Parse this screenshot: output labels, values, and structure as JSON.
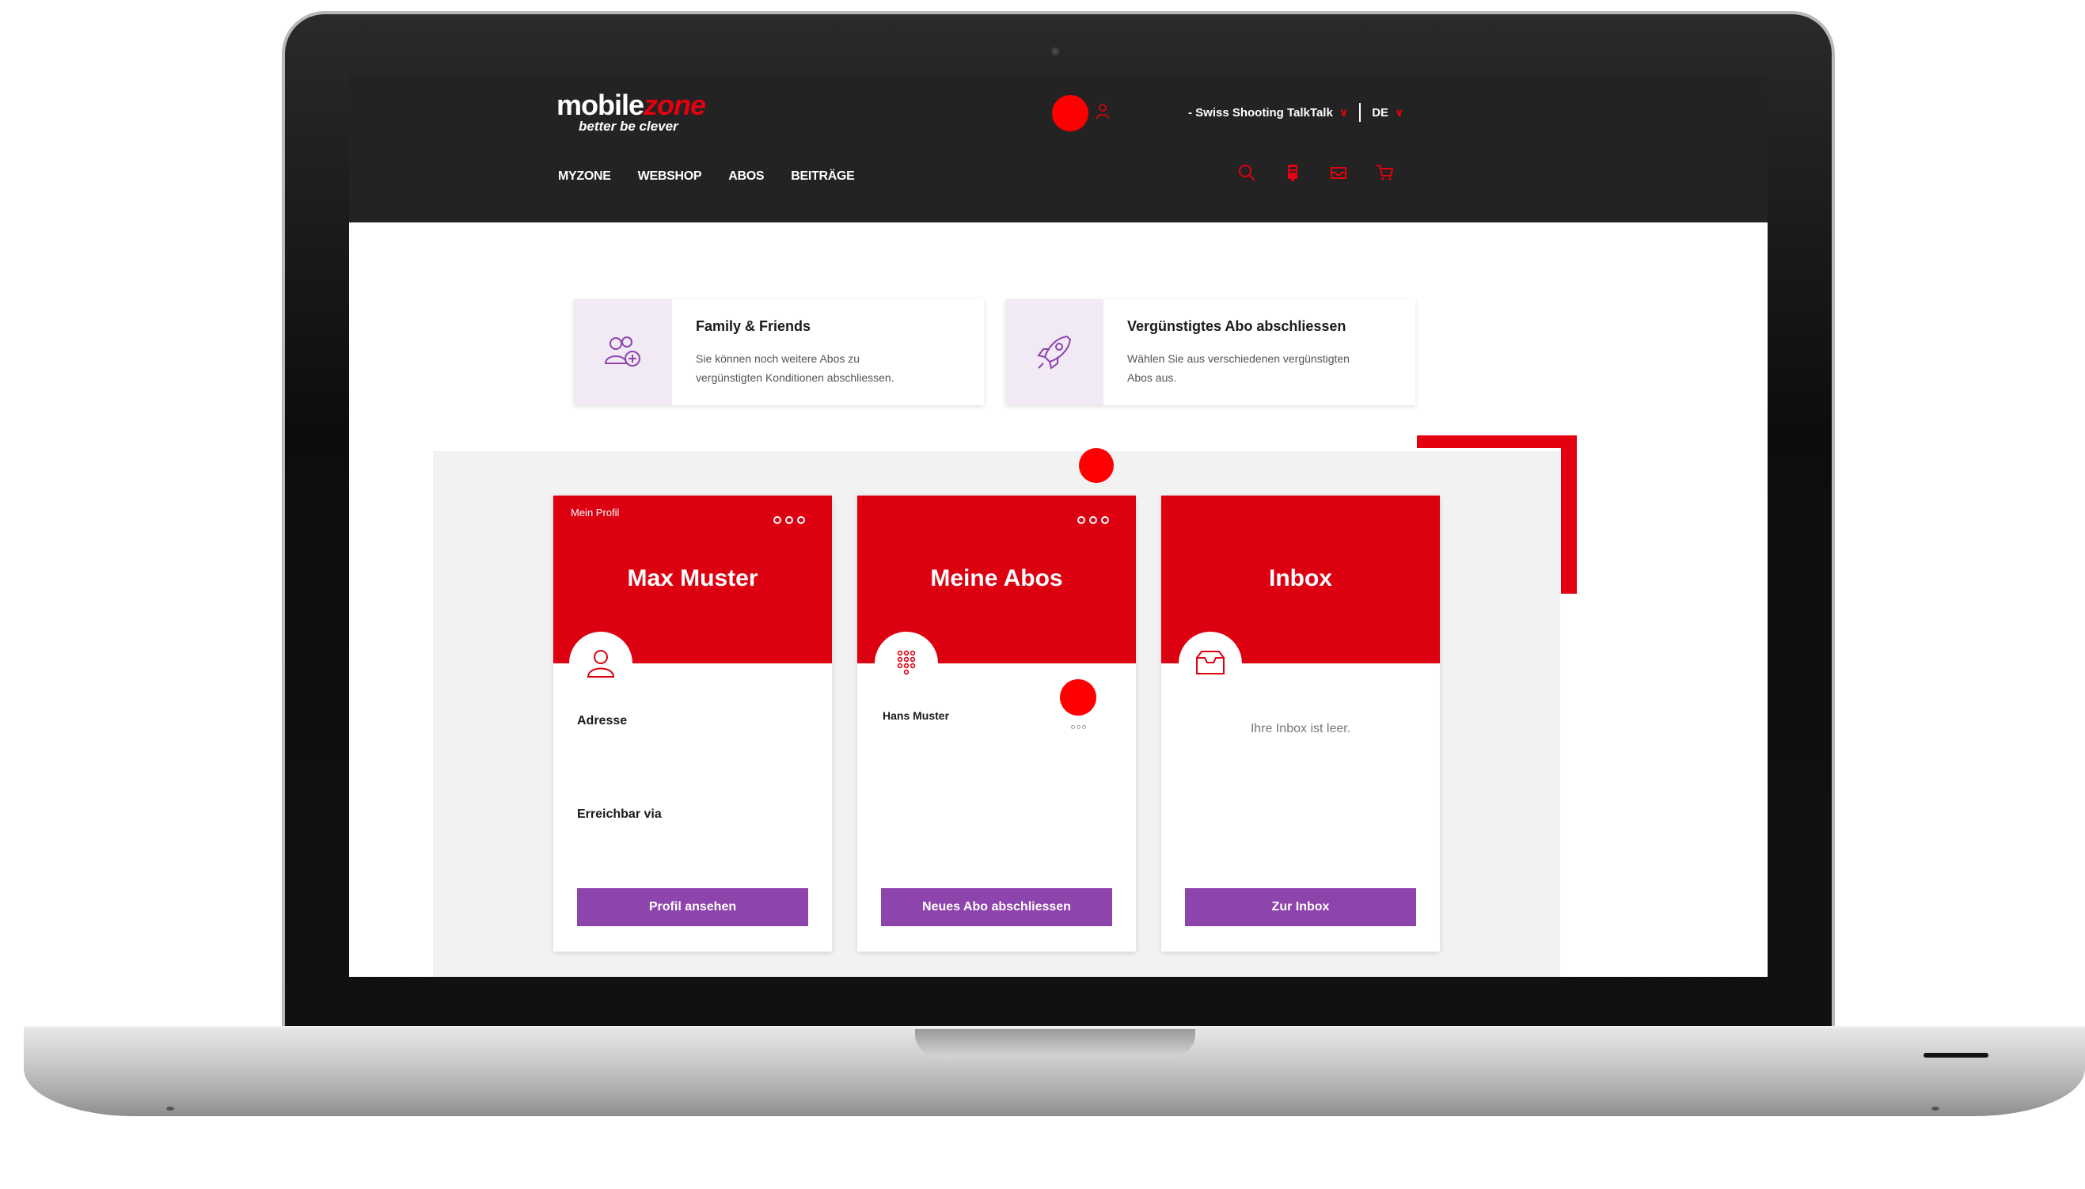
{
  "brand": {
    "name_part1": "mobile",
    "name_part2": "zone",
    "tagline": "better be clever",
    "accent_color": "#e3000f"
  },
  "header": {
    "profile_name": "- Swiss Shooting TalkTalk",
    "language": "DE",
    "nav": [
      "MYZONE",
      "WEBSHOP",
      "ABOS",
      "BEITRÄGE"
    ],
    "icons": [
      "search-icon",
      "mobile-icon",
      "inbox-icon",
      "cart-icon"
    ]
  },
  "promos": [
    {
      "title": "Family & Friends",
      "text_line1": "Sie können noch weitere Abos zu",
      "text_line2": "vergünstigten Konditionen abschliessen.",
      "icon": "family-add-icon"
    },
    {
      "title": "Vergünstigtes Abo abschliessen",
      "text_line1": "Wählen Sie aus verschiedenen vergünstigten",
      "text_line2": "Abos aus.",
      "icon": "rocket-icon"
    }
  ],
  "cards": {
    "profile": {
      "label": "Mein Profil",
      "title": "Max Muster",
      "address_label": "Adresse",
      "reach_label": "Erreichbar via",
      "button": "Profil ansehen"
    },
    "abos": {
      "title": "Meine Abos",
      "subscriber": "Hans Muster",
      "button": "Neues Abo abschliessen"
    },
    "inbox": {
      "title": "Inbox",
      "empty_text": "Ihre Inbox ist leer.",
      "button": "Zur Inbox"
    }
  },
  "colors": {
    "header_bg": "#232323",
    "card_red": "#dd0011",
    "button_purple": "#8e44ad",
    "panel_grey": "#f2f2f2"
  }
}
